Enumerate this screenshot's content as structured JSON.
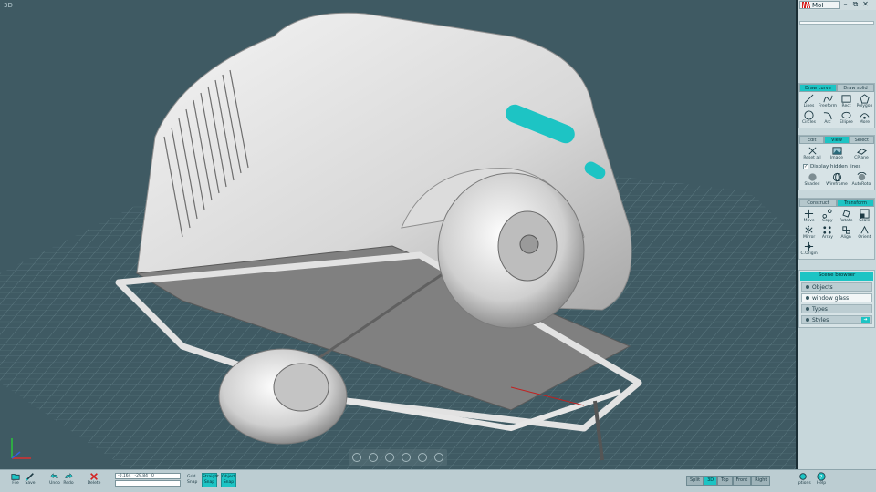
{
  "viewport": {
    "label": "3D"
  },
  "window": {
    "app_name": "MoI",
    "minimize": "–",
    "restore": "⧉",
    "close": "✕"
  },
  "draw": {
    "tabs": [
      "Draw curve",
      "Draw solid"
    ],
    "tools": [
      {
        "label": "Lines",
        "icon": "line-icon"
      },
      {
        "label": "Freeform",
        "icon": "freeform-icon"
      },
      {
        "label": "Rect",
        "icon": "rect-icon"
      },
      {
        "label": "Polygon",
        "icon": "polygon-icon"
      },
      {
        "label": "Circles",
        "icon": "circle-icon"
      },
      {
        "label": "Arc",
        "icon": "arc-icon"
      },
      {
        "label": "Ellipse",
        "icon": "ellipse-icon"
      },
      {
        "label": "More",
        "icon": "more-icon"
      }
    ]
  },
  "view": {
    "tabs": [
      "Edit",
      "View",
      "Select"
    ],
    "tools": [
      {
        "label": "Reset all",
        "icon": "reset-icon"
      },
      {
        "label": "Image",
        "icon": "image-icon"
      },
      {
        "label": "CPlane",
        "icon": "cplane-icon"
      }
    ],
    "checkbox_label": "Display hidden lines",
    "tools2": [
      {
        "label": "Shaded",
        "icon": "shaded-icon"
      },
      {
        "label": "Wireframe",
        "icon": "wireframe-icon"
      },
      {
        "label": "AutoRoto",
        "icon": "autorotate-icon"
      }
    ]
  },
  "construct": {
    "tabs": [
      "Construct",
      "Transform"
    ],
    "tools": [
      {
        "label": "Move",
        "icon": "move-icon"
      },
      {
        "label": "Copy",
        "icon": "copy-icon"
      },
      {
        "label": "Rotate",
        "icon": "rotate-icon"
      },
      {
        "label": "Scale",
        "icon": "scale-icon"
      },
      {
        "label": "Mirror",
        "icon": "mirror-icon"
      },
      {
        "label": "Array",
        "icon": "array-icon"
      },
      {
        "label": "Align",
        "icon": "align-icon"
      },
      {
        "label": "Orient",
        "icon": "orient-icon"
      },
      {
        "label": "C.Origin",
        "icon": "origin-icon"
      }
    ]
  },
  "scene_browser": {
    "title": "Scene browser",
    "rows": [
      {
        "label": "Objects"
      },
      {
        "label": "window glass"
      },
      {
        "label": "Types"
      },
      {
        "label": "Styles"
      }
    ]
  },
  "bottom": {
    "file": "File",
    "save": "Save",
    "undo": "Undo",
    "redo": "Redo",
    "delete": "Delete",
    "coord_x": "-0.164",
    "coord_y": "-29.84",
    "coord_z": "0",
    "grid_label": "Grid",
    "snap_label": "Snap",
    "straight_snap": "Straight Snap",
    "object_snap": "Object Snap",
    "options": "Options",
    "help": "Help"
  },
  "view_tabs": [
    "Split",
    "3D",
    "Top",
    "Front",
    "Right"
  ],
  "active_view_tab": "3D",
  "colors": {
    "accent": "#1dc4c4",
    "viewport_bg": "#3f5a63",
    "panel_bg": "#c7d7db"
  }
}
